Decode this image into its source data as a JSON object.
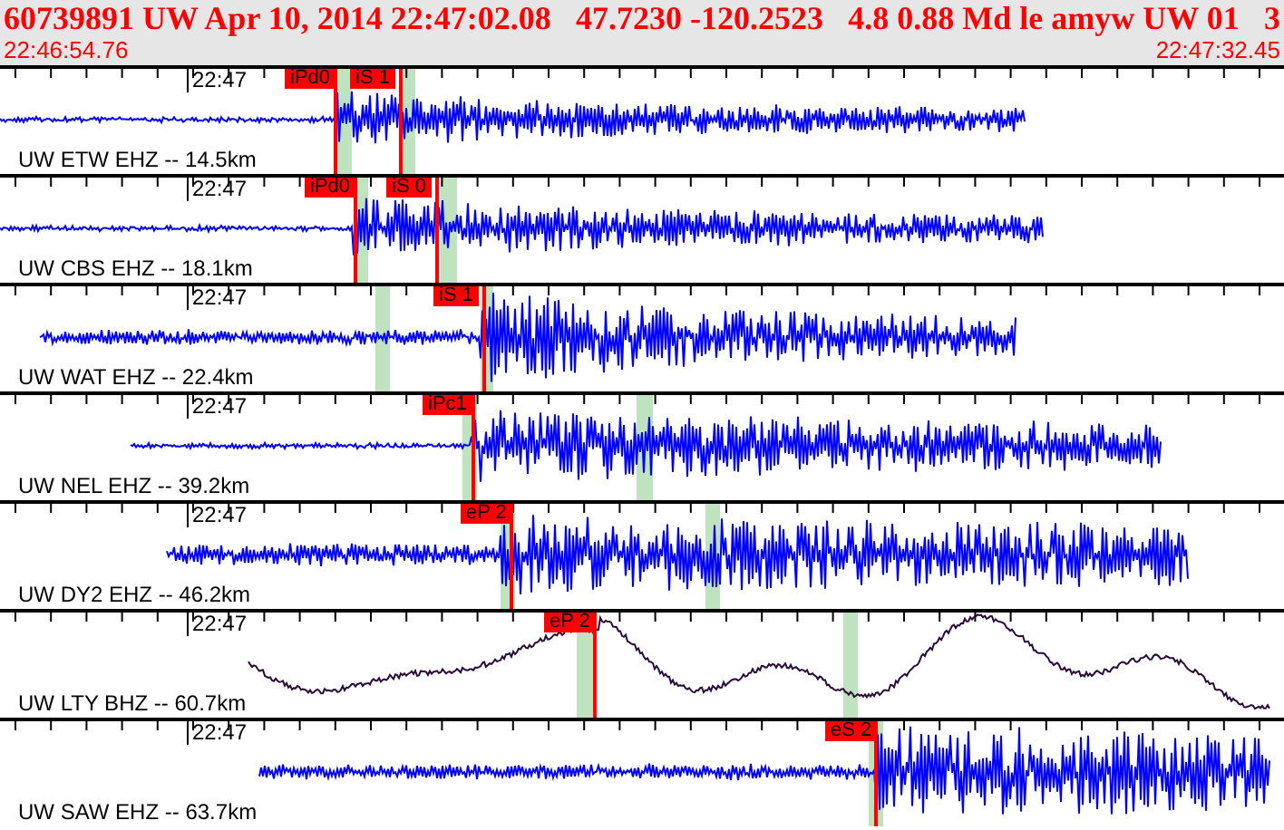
{
  "header": {
    "fields": [
      "60739891 UW Apr 10, 2014 22:47:02.08",
      "47.7230 -120.2523",
      "4.8 0.88 Md le amyw UW 01",
      "3"
    ],
    "start_time": "22:46:54.76",
    "end_time": "22:47:32.45"
  },
  "traces": [
    {
      "station": "UW ETW EHZ -- 14.5km",
      "time": "22:47",
      "picks": [
        {
          "label": "iPd0"
        },
        {
          "label": "iS 1"
        }
      ]
    },
    {
      "station": "UW CBS EHZ -- 18.1km",
      "time": "22:47",
      "picks": [
        {
          "label": "iPd0"
        },
        {
          "label": "iS 0"
        }
      ]
    },
    {
      "station": "UW WAT EHZ -- 22.4km",
      "time": "22:47",
      "picks": [
        {
          "label": "iS 1"
        }
      ]
    },
    {
      "station": "UW NEL EHZ -- 39.2km",
      "time": "22:47",
      "picks": [
        {
          "label": "iPc1"
        }
      ]
    },
    {
      "station": "UW DY2 EHZ -- 46.2km",
      "time": "22:47",
      "picks": [
        {
          "label": "eP 2"
        }
      ]
    },
    {
      "station": "UW LTY BHZ -- 60.7km",
      "time": "22:47",
      "picks": [
        {
          "label": "eP 2"
        }
      ]
    },
    {
      "station": "UW SAW EHZ -- 63.7km",
      "time": "22:47",
      "picks": [
        {
          "label": "eS 2"
        }
      ]
    }
  ]
}
